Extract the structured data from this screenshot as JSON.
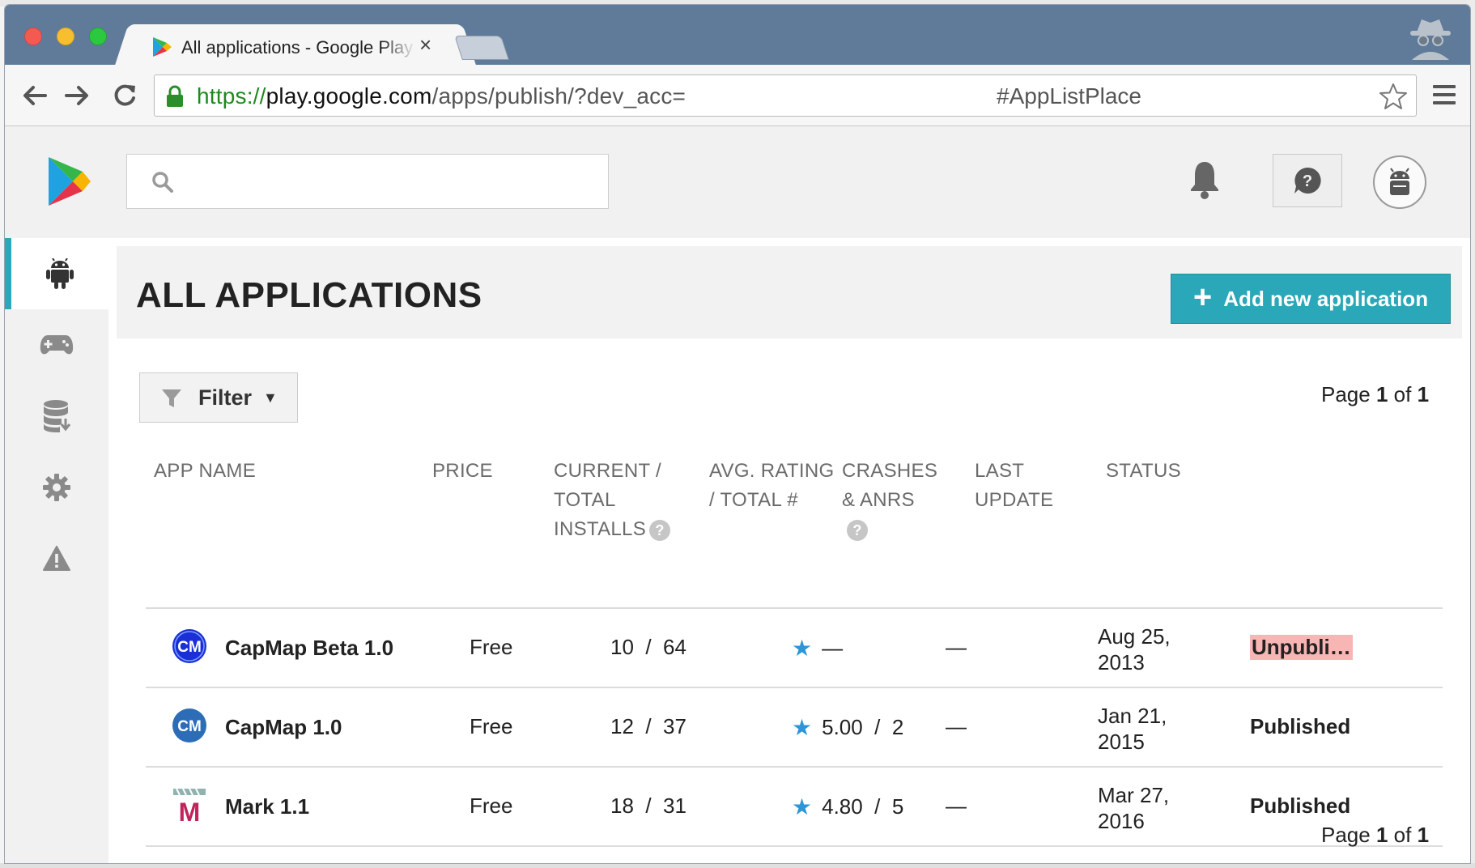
{
  "browser": {
    "tab_title": "All applications - Google Play Developer Console",
    "tab_close": "×",
    "url_scheme": "https://",
    "url_host": "play.google.com",
    "url_path": "/apps/publish/?dev_acc=",
    "url_hash": "#AppListPlace"
  },
  "header": {
    "search_placeholder": "",
    "icons": [
      "google-play-logo",
      "search-icon",
      "bell-icon",
      "help-icon",
      "android-avatar-icon"
    ]
  },
  "sidebar": {
    "items": [
      {
        "name": "all-applications",
        "icon": "android-icon",
        "active": true
      },
      {
        "name": "game-services",
        "icon": "gamepad-icon",
        "active": false
      },
      {
        "name": "download-reports",
        "icon": "database-download-icon",
        "active": false
      },
      {
        "name": "settings",
        "icon": "gear-icon",
        "active": false
      },
      {
        "name": "alerts",
        "icon": "warning-icon",
        "active": false
      }
    ]
  },
  "main": {
    "title": "ALL APPLICATIONS",
    "add_button_plus": "+",
    "add_button_label": "Add new application",
    "filter_label": "Filter",
    "filter_caret": "▼",
    "pager_top": {
      "prefix": "Page",
      "current": "1",
      "of": "of",
      "total": "1"
    },
    "pager_bottom": {
      "prefix": "Page",
      "current": "1",
      "of": "of",
      "total": "1"
    },
    "columns": {
      "app_name": "APP NAME",
      "price": "PRICE",
      "installs_l1": "CURRENT /",
      "installs_l2": "TOTAL",
      "installs_l3": "INSTALLS",
      "rating_l1": "AVG. RATING",
      "rating_l2": "/ TOTAL #",
      "crashes_l1": "CRASHES",
      "crashes_l2": "& ANRS",
      "update_l1": "LAST",
      "update_l2": "UPDATE",
      "status": "STATUS",
      "help_mark": "?"
    },
    "apps": [
      {
        "name": "CapMap Beta 1.0",
        "icon_text": "CM",
        "price": "Free",
        "installs": "10  /  64",
        "star": "★",
        "rating": "—",
        "crashes": "—",
        "updated_l1": "Aug 25,",
        "updated_l2": "2013",
        "status": "Unpubli…"
      },
      {
        "name": "CapMap 1.0",
        "icon_text": "CM",
        "price": "Free",
        "installs": "12  /  37",
        "star": "★",
        "rating": "5.00  /  2",
        "crashes": "—",
        "updated_l1": "Jan 21,",
        "updated_l2": "2015",
        "status": "Published"
      },
      {
        "name": "Mark 1.1",
        "icon_text": "M",
        "price": "Free",
        "installs": "18  /  31",
        "star": "★",
        "rating": "4.80  /  5",
        "crashes": "—",
        "updated_l1": "Mar 27,",
        "updated_l2": "2016",
        "status": "Published"
      }
    ]
  },
  "colors": {
    "accent": "#2aa7b8",
    "star": "#2e95d8",
    "unpublished_bg": "#f7b6b4",
    "tabstrip": "#5f7b99",
    "capmap_beta_icon": "#1a2fd6",
    "capmap_icon": "#2d6db8",
    "mark_icon": "#c0245a"
  }
}
